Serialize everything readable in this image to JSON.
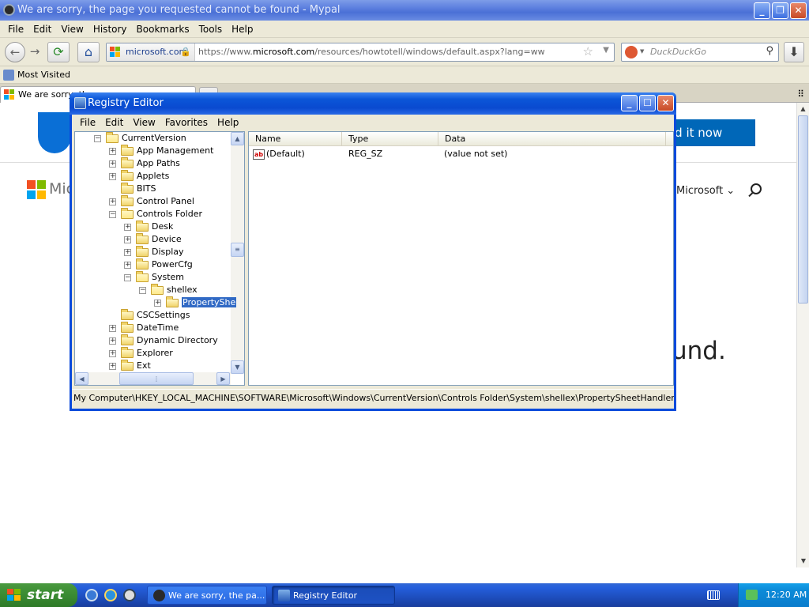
{
  "browser": {
    "title": "We are sorry, the page you requested cannot be found - Mypal",
    "menu": [
      "File",
      "Edit",
      "View",
      "History",
      "Bookmarks",
      "Tools",
      "Help"
    ],
    "identity": "microsoft.com",
    "url_prefix": "https://www.",
    "url_domain": "microsoft.com",
    "url_path": "/resources/howtotell/windows/default.aspx?lang=ww",
    "search_placeholder": "DuckDuckGo",
    "bookmarks_label": "Most Visited",
    "tab_title": "We are sorry, th..."
  },
  "page": {
    "cta": "ld it now",
    "logo_text": "Mic",
    "all_microsoft": "Microsoft ⌄",
    "not_found_fragment": "und."
  },
  "regedit": {
    "title": "Registry Editor",
    "menu": [
      "File",
      "Edit",
      "View",
      "Favorites",
      "Help"
    ],
    "tree": [
      {
        "label": "CurrentVersion",
        "indent": 0,
        "expander": "minus",
        "open": true
      },
      {
        "label": "App Management",
        "indent": 1,
        "expander": "plus"
      },
      {
        "label": "App Paths",
        "indent": 1,
        "expander": "plus"
      },
      {
        "label": "Applets",
        "indent": 1,
        "expander": "plus"
      },
      {
        "label": "BITS",
        "indent": 1,
        "expander": "none"
      },
      {
        "label": "Control Panel",
        "indent": 1,
        "expander": "plus"
      },
      {
        "label": "Controls Folder",
        "indent": 1,
        "expander": "minus",
        "open": true
      },
      {
        "label": "Desk",
        "indent": 2,
        "expander": "plus"
      },
      {
        "label": "Device",
        "indent": 2,
        "expander": "plus"
      },
      {
        "label": "Display",
        "indent": 2,
        "expander": "plus"
      },
      {
        "label": "PowerCfg",
        "indent": 2,
        "expander": "plus"
      },
      {
        "label": "System",
        "indent": 2,
        "expander": "minus",
        "open": true
      },
      {
        "label": "shellex",
        "indent": 3,
        "expander": "minus",
        "open": true
      },
      {
        "label": "PropertyShe",
        "indent": 4,
        "expander": "plus",
        "selected": true
      },
      {
        "label": "CSCSettings",
        "indent": 1,
        "expander": "none"
      },
      {
        "label": "DateTime",
        "indent": 1,
        "expander": "plus"
      },
      {
        "label": "Dynamic Directory",
        "indent": 1,
        "expander": "plus"
      },
      {
        "label": "Explorer",
        "indent": 1,
        "expander": "plus"
      },
      {
        "label": "Ext",
        "indent": 1,
        "expander": "plus"
      }
    ],
    "columns": {
      "name": "Name",
      "type": "Type",
      "data": "Data"
    },
    "values": [
      {
        "icon": "ab",
        "name": "(Default)",
        "type": "REG_SZ",
        "data": "(value not set)"
      }
    ],
    "status": "My Computer\\HKEY_LOCAL_MACHINE\\SOFTWARE\\Microsoft\\Windows\\CurrentVersion\\Controls Folder\\System\\shellex\\PropertySheetHandlers"
  },
  "taskbar": {
    "start": "start",
    "tasks": [
      {
        "label": "We are sorry, the pa...",
        "active": false
      },
      {
        "label": "Registry Editor",
        "active": true
      }
    ],
    "clock": "12:20 AM"
  },
  "colors": {
    "xp_blue": "#0a4adb",
    "selection": "#316ac5",
    "ms_button": "#0067b8"
  }
}
